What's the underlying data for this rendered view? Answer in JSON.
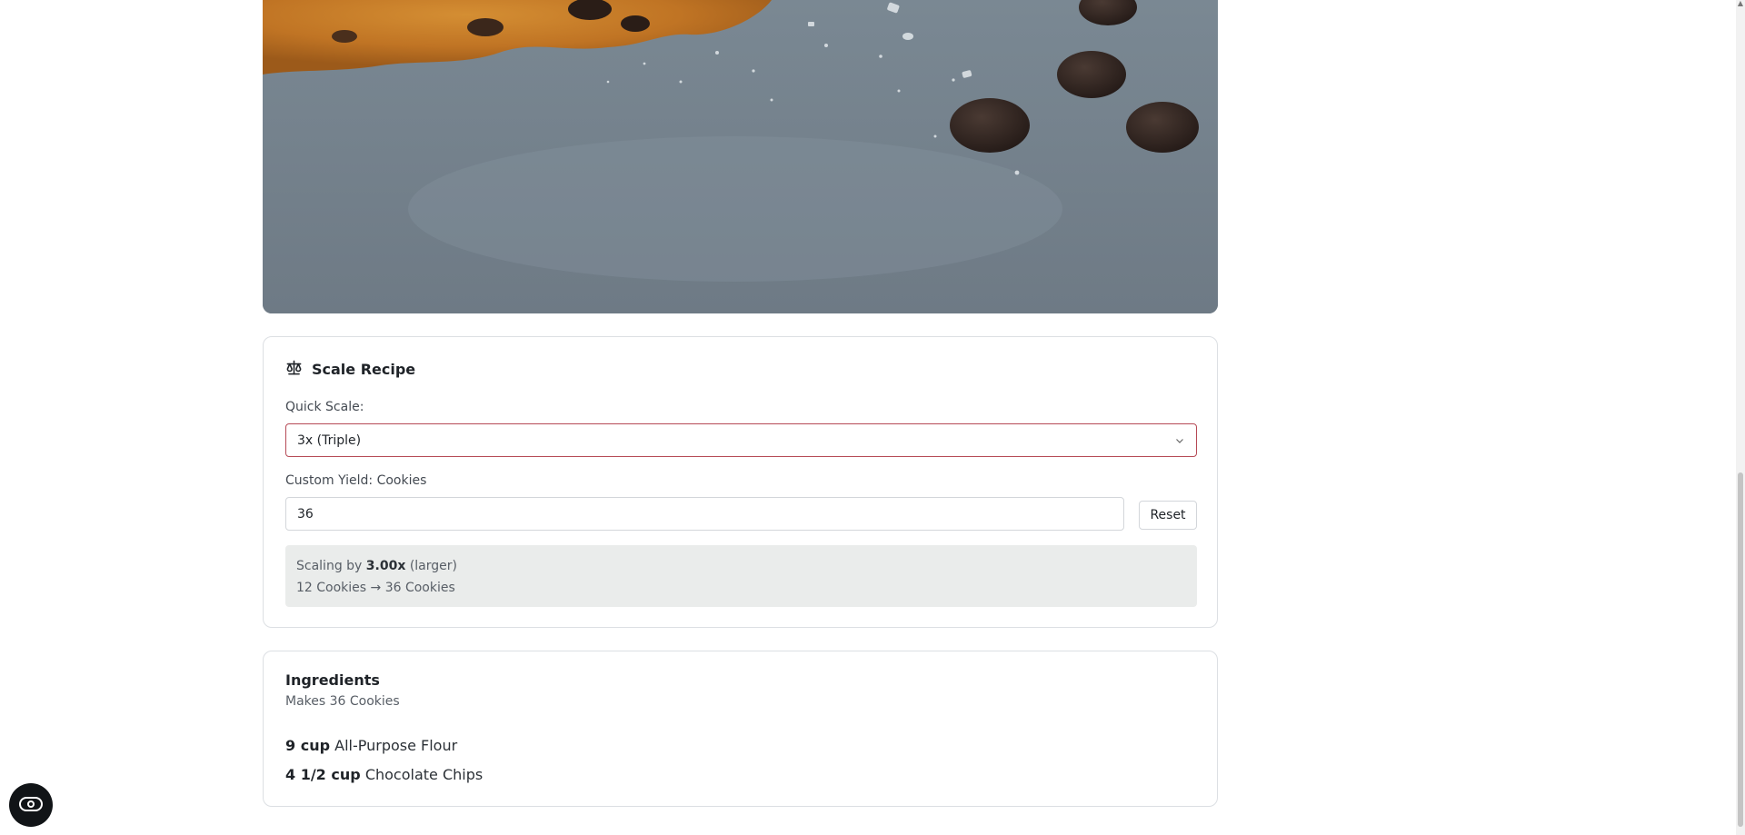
{
  "hero": {
    "image": "chocolate-chip-cookie-photo"
  },
  "scale": {
    "title": "Scale Recipe",
    "quick_label": "Quick Scale:",
    "quick_value": "3x (Triple)",
    "custom_label": "Custom Yield: Cookies",
    "custom_value": "36",
    "reset_label": "Reset",
    "summary_prefix": "Scaling by",
    "factor": "3.00x",
    "summary_suffix": "(larger)",
    "conversion": "12 Cookies → 36 Cookies"
  },
  "ingredients": {
    "title": "Ingredients",
    "subtitle": "Makes 36 Cookies",
    "items": [
      {
        "qty": "9 cup",
        "name": "All-Purpose Flour"
      },
      {
        "qty": "4 1/2 cup",
        "name": "Chocolate Chips"
      }
    ]
  },
  "icons": {
    "scale": "balance-scale-icon",
    "chevron": "chevron-down-icon",
    "fab": "open-eye-icon"
  }
}
